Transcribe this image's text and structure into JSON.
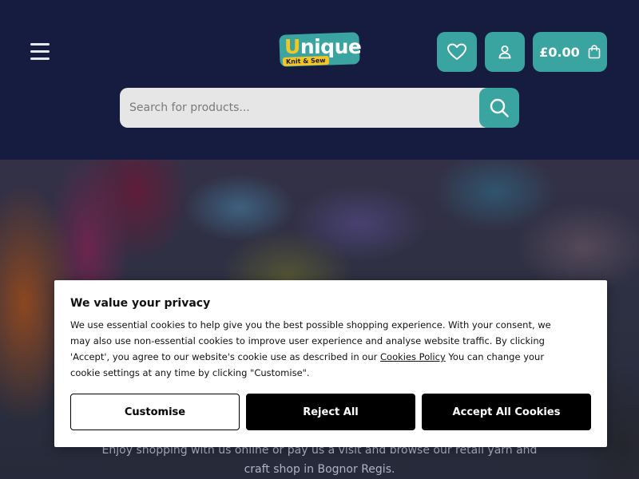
{
  "header": {
    "logo": {
      "word_first": "U",
      "word_rest": "nique",
      "subtitle": "Knit & Sew"
    },
    "cart_total": "£0.00",
    "search_placeholder": "Search for products..."
  },
  "hero": {
    "tagline": "Enjoy shopping with us online or pay us a visit and browse our retail yarn and craft shop in Bognor Regis."
  },
  "cookie_banner": {
    "title": "We value your privacy",
    "text_before_link": "We use essential cookies to help give you the best possible shopping experience. With your consent, we may also use non-essential cookies to improve user experience and analyse website traffic. By clicking 'Accept', you agree to our website's cookie use as described in our ",
    "link_label": "Cookies Policy",
    "text_after_link": " You can change your cookie settings at any time by clicking \"Customise\".",
    "buttons": {
      "customise": "Customise",
      "reject": "Reject All",
      "accept": "Accept All Cookies"
    }
  },
  "colors": {
    "header_bg": "#151c40",
    "accent_teal": "#3aa4a0",
    "logo_yellow": "#f3c623"
  },
  "icons": {
    "menu": "hamburger-icon",
    "wishlist": "heart-icon",
    "account": "user-icon",
    "cart": "shopping-bag-icon",
    "search": "search-icon"
  }
}
